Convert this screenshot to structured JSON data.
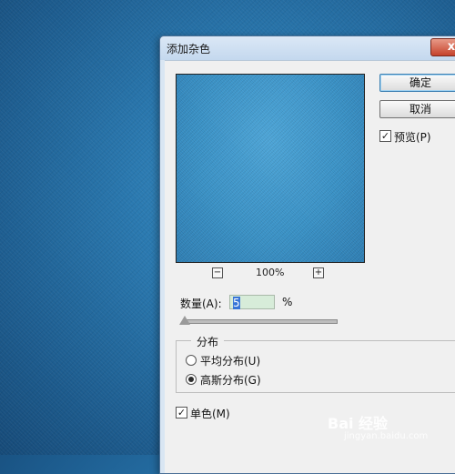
{
  "dialog": {
    "title": "添加杂色",
    "close_label": "x",
    "ok_label": "确定",
    "cancel_label": "取消",
    "preview_label": "预览(P)",
    "preview_checked": true,
    "zoom": {
      "minus": "−",
      "plus": "+",
      "value": "100%"
    },
    "amount": {
      "label": "数量(A):",
      "value": "5",
      "unit": "%"
    },
    "distribution": {
      "title": "分布",
      "uniform_label": "平均分布(U)",
      "gaussian_label": "高斯分布(G)",
      "selected": "gaussian"
    },
    "monochromatic_label": "单色(M)",
    "monochromatic_checked": true
  },
  "watermark": {
    "text": "Bai 经验",
    "url": "jingyan.baidu.com"
  }
}
